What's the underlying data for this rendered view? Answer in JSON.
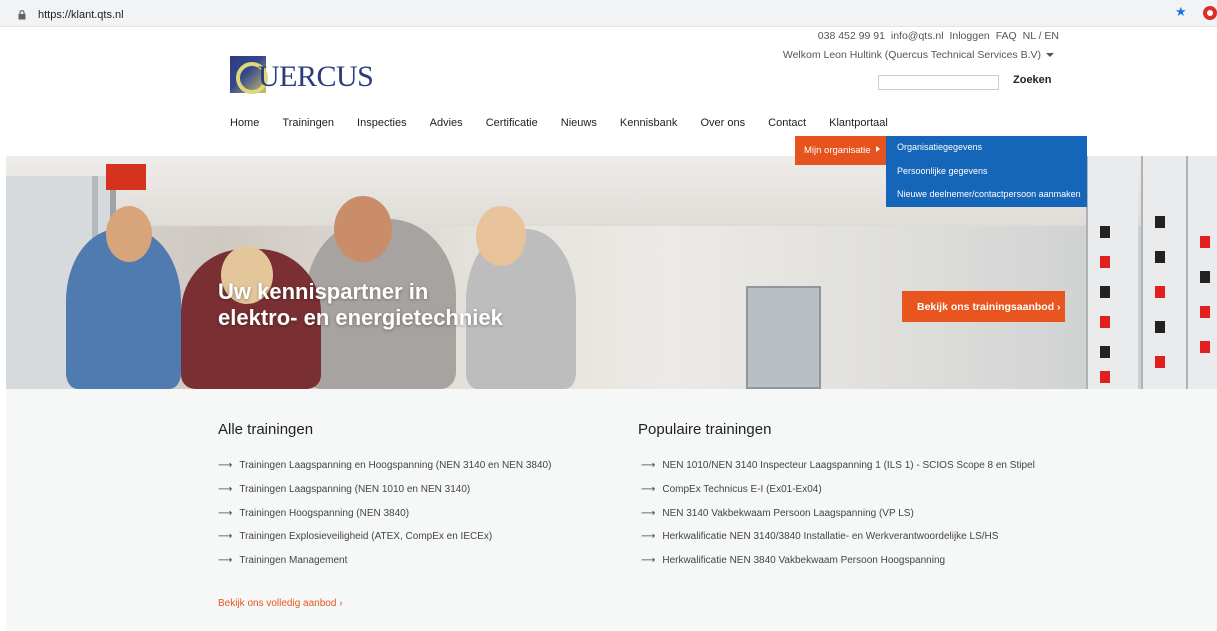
{
  "browser": {
    "url": "https://klant.qts.nl"
  },
  "header": {
    "phone": "038 452 99 91",
    "email": "info@qts.nl",
    "login": "Inloggen",
    "faq": "FAQ",
    "language": "NL / EN",
    "welcome": "Welkom Leon Hultink (Quercus Technical Services B.V)",
    "logo_text": "UERCUS",
    "search_button": "Zoeken",
    "search_placeholder": ""
  },
  "nav": {
    "items": [
      "Home",
      "Trainingen",
      "Inspecties",
      "Advies",
      "Certificatie",
      "Nieuws",
      "Kennisbank",
      "Over ons",
      "Contact",
      "Klantportaal"
    ]
  },
  "dropdown": {
    "parent": "Mijn organisatie",
    "items": [
      "Organisatiegegevens",
      "Persoonlijke gegevens",
      "Nieuwe deelnemer/contactpersoon aanmaken"
    ]
  },
  "hero": {
    "line1": "Uw kennispartner in",
    "line2": "elektro- en energietechniek",
    "cta": "Bekijk ons trainingsaanbod ›"
  },
  "alle_trainingen": {
    "title": "Alle trainingen",
    "arrow": "⟶",
    "items": [
      "Trainingen Laagspanning en Hoogspanning (NEN 3140 en NEN 3840)",
      "Trainingen Laagspanning (NEN 1010 en NEN 3140)",
      "Trainingen Hoogspanning (NEN 3840)",
      "Trainingen Explosieveiligheid (ATEX, CompEx en IECEx)",
      "Trainingen Management"
    ],
    "more_link": "Bekijk ons volledig aanbod ›"
  },
  "populaire_trainingen": {
    "title": "Populaire trainingen",
    "items": [
      "NEN 1010/NEN 3140 Inspecteur Laagspanning 1 (ILS 1) - SCIOS Scope 8 en Stipel",
      "CompEx Technicus E-I (Ex01-Ex04)",
      "NEN 3140 Vakbekwaam Persoon Laagspanning (VP LS)",
      "Herkwalificatie NEN 3140/3840 Installatie- en Werkverantwoordelijke LS/HS",
      "Herkwalificatie NEN 3840 Vakbekwaam Persoon Hoogspanning"
    ]
  },
  "colors": {
    "accent_orange": "#e8551e",
    "dropdown_blue": "#1565b8",
    "logo_blue": "#2d3a7c"
  }
}
